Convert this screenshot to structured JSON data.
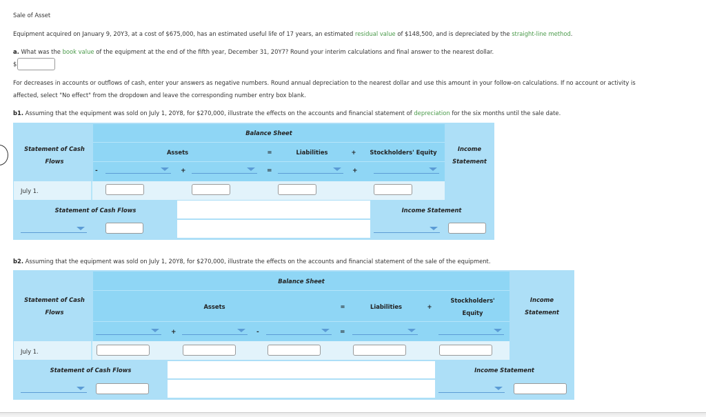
{
  "title": "Sale of Asset",
  "intro": {
    "p1": "Equipment acquired on January 9, 20Y3, at a cost of $675,000, has an estimated useful life of 17 years, an estimated ",
    "link1": "residual value",
    "p2": " of $148,500, and is depreciated by the ",
    "link2": "straight-line method",
    "p3": "."
  },
  "part_a": {
    "label": "a.",
    "q1": " What was the ",
    "link": "book value",
    "q2": " of the equipment at the end of the fifth year, December 31, 20Y7? Round your interim calculations and final answer to the nearest dollar.",
    "currency": "$",
    "value": ""
  },
  "instructions": {
    "line1": "For decreases in accounts or outflows of cash, enter your answers as negative numbers. Round annual depreciation to the nearest dollar and use this amount in your follow-on calculations. If no account or activity is",
    "line2": "affected, select \"No effect\" from the dropdown and leave the corresponding number entry box blank."
  },
  "part_b1": {
    "label": "b1.",
    "q1": " Assuming that the equipment was sold on July 1, 20Y8, for $270,000, illustrate the effects on the accounts and financial statement of ",
    "link": "depreciation",
    "q2": " for the six months until the sale date.",
    "table": {
      "scf_header": "Statement of Cash Flows",
      "bs_header": "Balance Sheet",
      "assets": "Assets",
      "eq1": "=",
      "liabilities": "Liabilities",
      "plus1": "+",
      "equity": "Stockholders' Equity",
      "is_header": "Income Statement",
      "ops": [
        "-",
        "+",
        "=",
        "+"
      ],
      "row_label": "July 1.",
      "scf_footer": "Statement of Cash Flows",
      "is_footer": "Income Statement"
    }
  },
  "part_b2": {
    "label": "b2.",
    "q": " Assuming that the equipment was sold on July 1, 20Y8, for $270,000, illustrate the effects on the accounts and financial statement of the sale of the equipment.",
    "table": {
      "scf_header": "Statement of Cash Flows",
      "bs_header": "Balance Sheet",
      "assets": "Assets",
      "eq1": "=",
      "liabilities": "Liabilities",
      "plus1": "+",
      "equity1": "Stockholders'",
      "equity2": "Equity",
      "is_header": "Income Statement",
      "ops": [
        "+",
        "-",
        "="
      ],
      "row_label": "July 1.",
      "scf_footer": "Statement of Cash Flows",
      "is_footer": "Income Statement"
    }
  }
}
